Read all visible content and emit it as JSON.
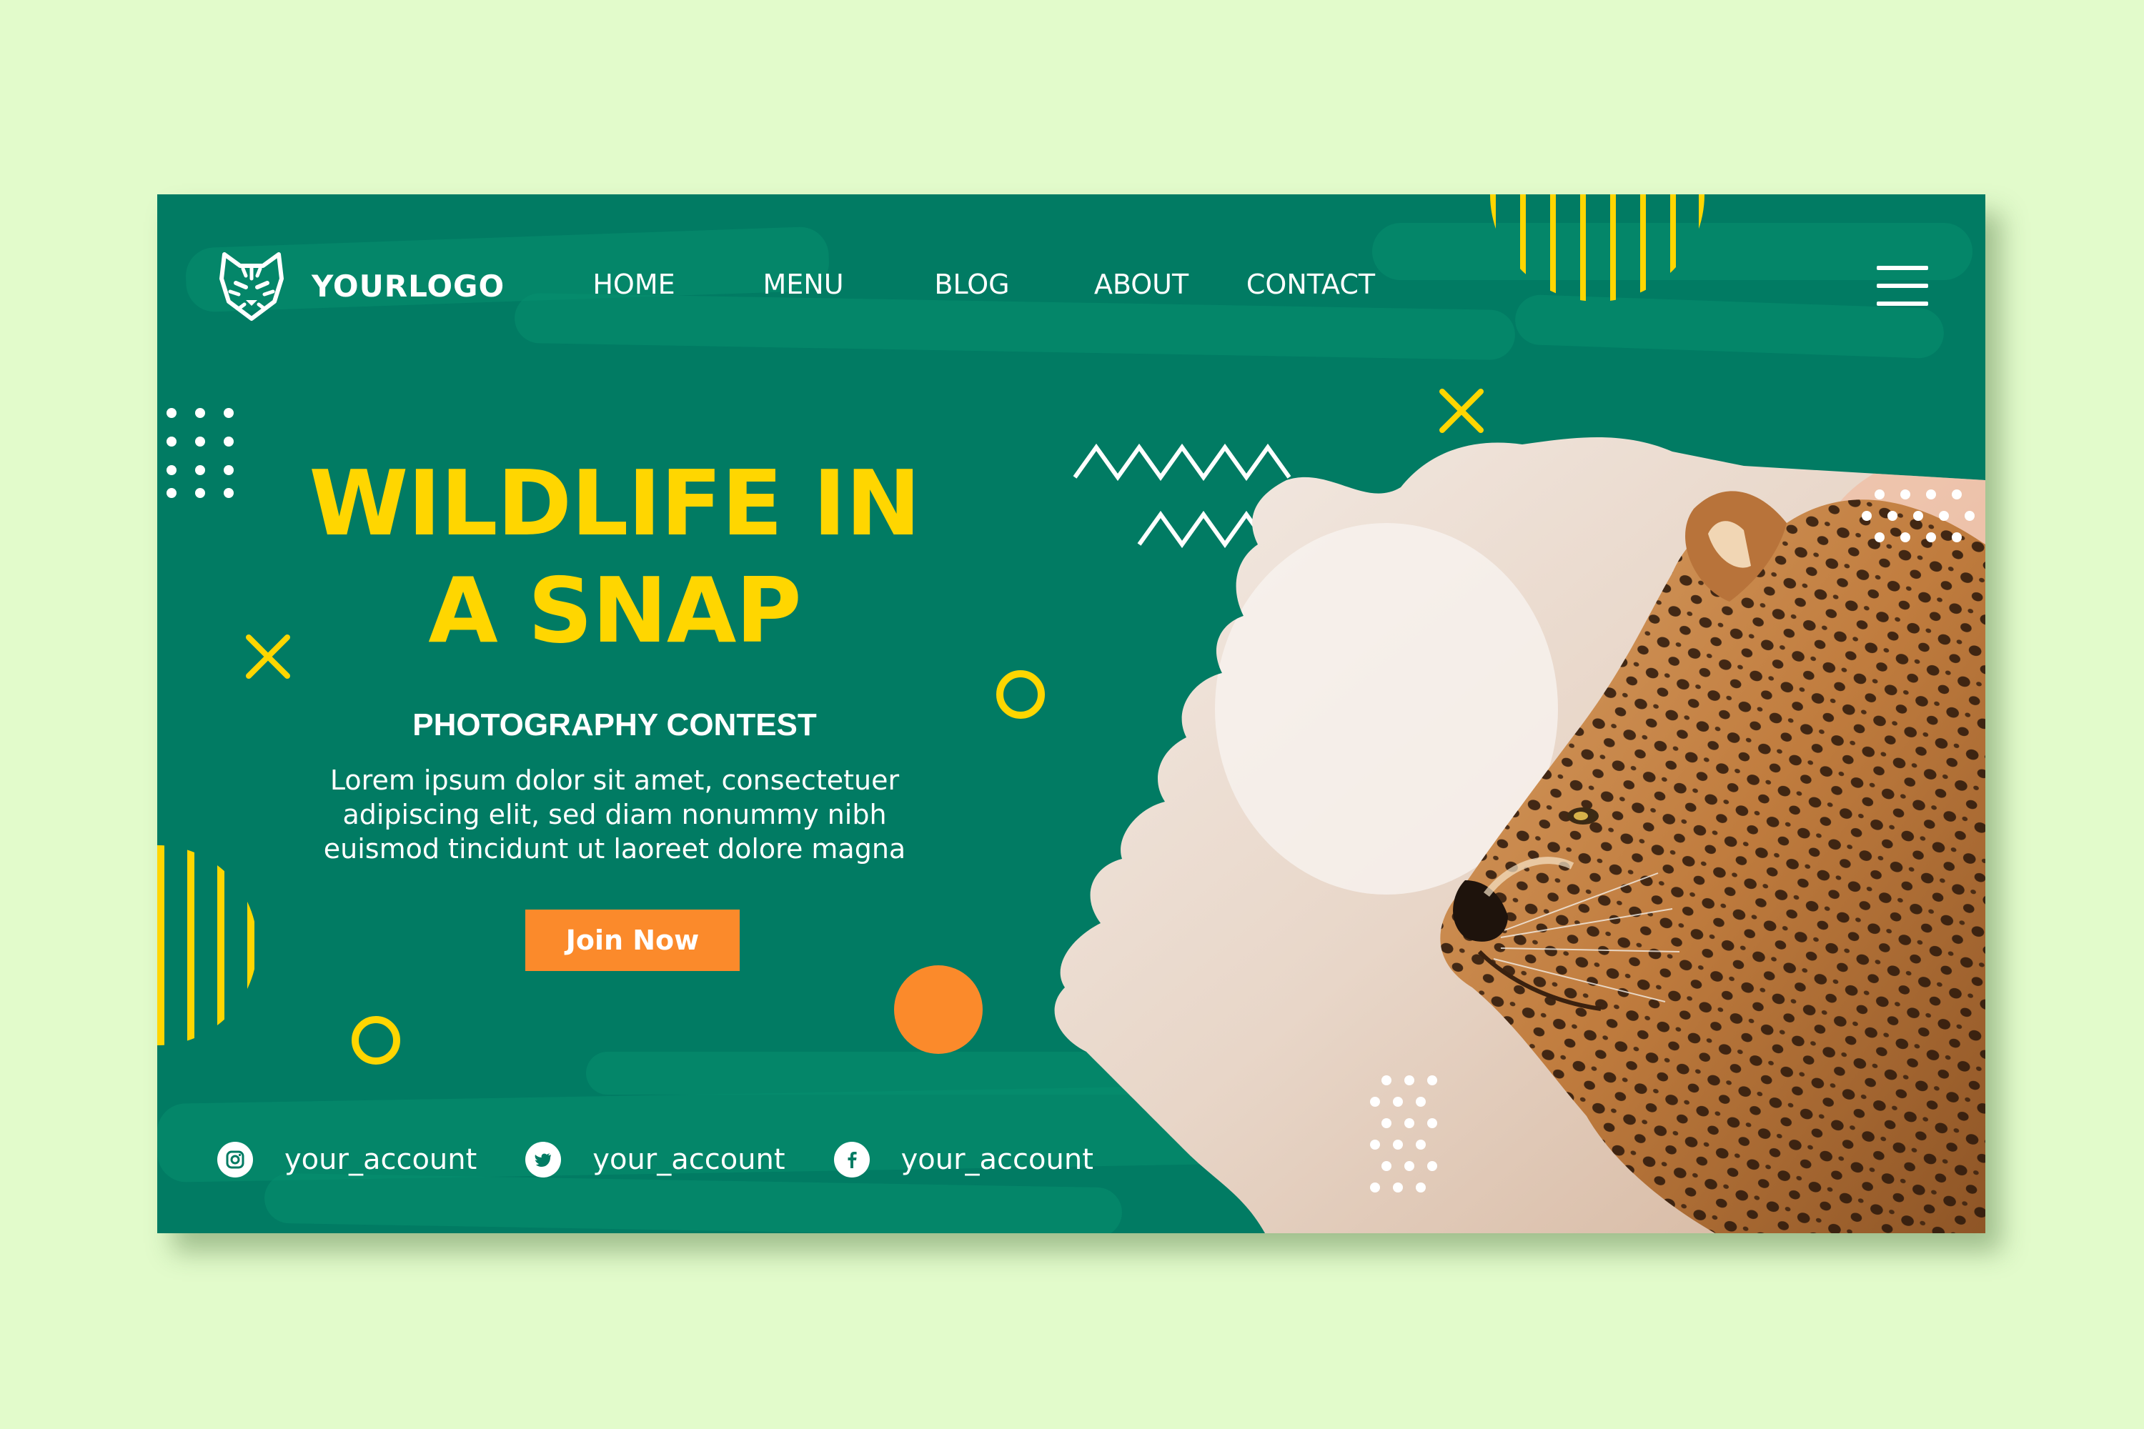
{
  "logo": {
    "text": "YOURLOGO"
  },
  "nav": {
    "items": [
      {
        "label": "HOME"
      },
      {
        "label": "MENU"
      },
      {
        "label": "BLOG"
      },
      {
        "label": "ABOUT"
      },
      {
        "label": "CONTACT"
      }
    ]
  },
  "hero": {
    "title_line1": "WILDLIFE IN",
    "title_line2": "A SNAP",
    "subtitle": "PHOTOGRAPHY CONTEST",
    "description": "Lorem ipsum dolor sit amet, consectetuer adipiscing elit, sed diam nonummy nibh euismod tincidunt ut laoreet dolore magna",
    "cta_label": "Join Now"
  },
  "social": {
    "items": [
      {
        "icon": "instagram-icon",
        "label": "your_account"
      },
      {
        "icon": "twitter-icon",
        "label": "your_account"
      },
      {
        "icon": "facebook-icon",
        "label": "your_account"
      }
    ]
  },
  "colors": {
    "page_bg": "#e2fbcb",
    "card_bg": "#017b63",
    "accent_yellow": "#ffd600",
    "accent_orange": "#fb8a2b",
    "text": "#ffffff"
  }
}
